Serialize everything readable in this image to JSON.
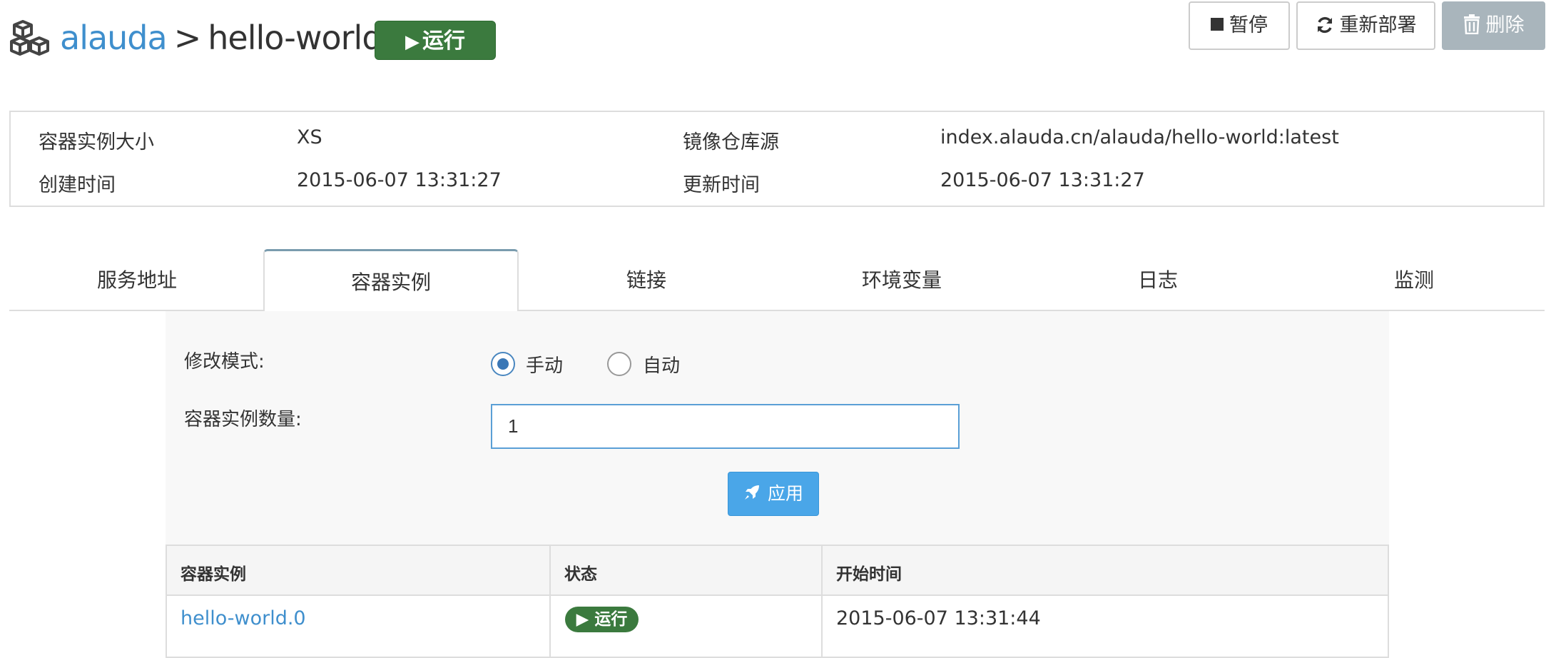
{
  "header": {
    "logo_icon": "cubes-icon",
    "breadcrumb_root": "alauda",
    "breadcrumb_separator": ">",
    "breadcrumb_current": "hello-world",
    "status_label": "运行",
    "status_icon": "play-icon"
  },
  "toolbar": {
    "pause_label": "暂停",
    "pause_icon": "stop-square-icon",
    "redeploy_label": "重新部署",
    "redeploy_icon": "refresh-icon",
    "delete_label": "删除",
    "delete_icon": "trash-icon"
  },
  "info": {
    "size_label": "容器实例大小",
    "size_value": "XS",
    "image_label": "镜像仓库源",
    "image_value": "index.alauda.cn/alauda/hello-world:latest",
    "created_label": "创建时间",
    "created_value": "2015-06-07 13:31:27",
    "updated_label": "更新时间",
    "updated_value": "2015-06-07 13:31:27"
  },
  "tabs": [
    {
      "label": "服务地址",
      "active": false
    },
    {
      "label": "容器实例",
      "active": true
    },
    {
      "label": "链接",
      "active": false
    },
    {
      "label": "环境变量",
      "active": false
    },
    {
      "label": "日志",
      "active": false
    },
    {
      "label": "监测",
      "active": false
    }
  ],
  "form": {
    "mode_label": "修改模式:",
    "manual_label": "手动",
    "auto_label": "自动",
    "selected_mode": "手动",
    "count_label": "容器实例数量:",
    "count_value": "1",
    "apply_label": "应用",
    "apply_icon": "rocket-icon"
  },
  "instances_table": {
    "columns": [
      "容器实例",
      "状态",
      "开始时间"
    ],
    "rows": [
      {
        "name": "hello-world.0",
        "status": "运行",
        "start_time": "2015-06-07 13:31:44"
      }
    ]
  },
  "colors": {
    "link": "#3f8fcd",
    "running_green": "#3b7a3e",
    "apply_blue": "#4aa6e8",
    "delete_gray": "#a9b5bc",
    "active_tab_top": "#7a9cae"
  }
}
